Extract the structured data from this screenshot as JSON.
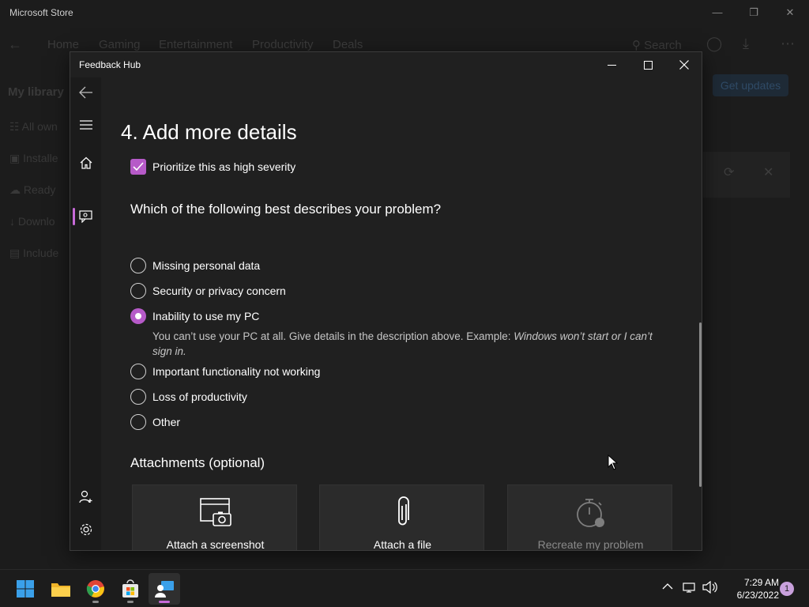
{
  "store": {
    "title": "Microsoft Store",
    "nav_tabs": [
      "Home",
      "Gaming",
      "Entertainment",
      "Productivity",
      "Deals"
    ],
    "search_label": "Search",
    "library_header": "My library",
    "library_items": [
      "All own",
      "Installe",
      "Ready",
      "Downlo",
      "Include"
    ],
    "get_updates": "Get updates"
  },
  "feedback_hub": {
    "title": "Feedback Hub",
    "section_title": "4. Add more details",
    "priority_label": "Prioritize this as high severity",
    "priority_checked": true,
    "question": "Which of the following best describes your problem?",
    "options": [
      "Missing personal data",
      "Security or privacy concern",
      "Inability to use my PC",
      "Important functionality not working",
      "Loss of productivity",
      "Other"
    ],
    "selected_option": "Inability to use my PC",
    "selected_help": "You can’t use your PC at all. Give details in the description above. Example: ",
    "selected_help_example": "Windows won’t start or I can’t sign in.",
    "attachments_header": "Attachments (optional)",
    "tiles": {
      "screenshot": "Attach a screenshot",
      "file": "Attach a file",
      "recreate": "Recreate my problem"
    },
    "accent_color": "#b65ac8"
  },
  "taskbar": {
    "apps": [
      "start-icon",
      "file-explorer-icon",
      "chrome-icon",
      "store-icon",
      "feedback-hub-icon"
    ],
    "time": "7:29 AM",
    "date": "6/23/2022",
    "notification_count": "1"
  }
}
